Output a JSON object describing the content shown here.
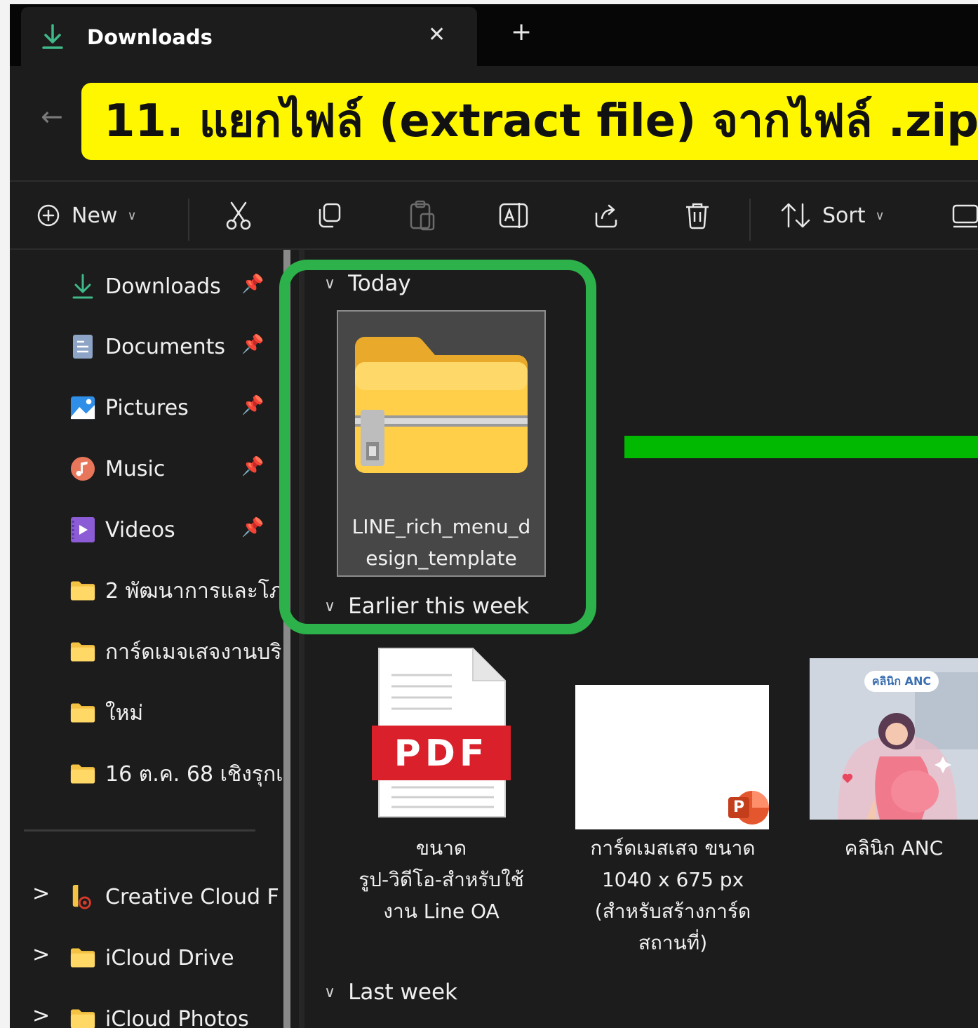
{
  "window": {
    "tab_title": "Downloads",
    "tab_close": "✕",
    "new_tab": "+",
    "back": "←"
  },
  "banner": {
    "text": "11. แยกไฟล์ (extract file) จากไฟล์ .zip",
    "color": "#fff700"
  },
  "toolbar": {
    "new_label": "New",
    "sort_label": "Sort",
    "icons": [
      "cut-icon",
      "copy-icon",
      "paste-icon",
      "rename-icon",
      "share-icon",
      "delete-icon",
      "view-icon"
    ]
  },
  "sidebar": {
    "quick_access": [
      {
        "label": "Downloads",
        "icon": "download-icon",
        "pinned": true
      },
      {
        "label": "Documents",
        "icon": "document-icon",
        "pinned": true
      },
      {
        "label": "Pictures",
        "icon": "pictures-icon",
        "pinned": true
      },
      {
        "label": "Music",
        "icon": "music-icon",
        "pinned": true
      },
      {
        "label": "Videos",
        "icon": "videos-icon",
        "pinned": true
      },
      {
        "label": "2 พัฒนาการและโภ",
        "icon": "folder-icon",
        "pinned": false
      },
      {
        "label": "การ์ดเมจเสจงานบริ",
        "icon": "folder-icon",
        "pinned": false
      },
      {
        "label": "ใหม่",
        "icon": "folder-icon",
        "pinned": false
      },
      {
        "label": "16 ต.ค. 68 เชิงรุกเ",
        "icon": "folder-icon",
        "pinned": false
      }
    ],
    "locations": [
      {
        "label": "Creative Cloud F",
        "icon": "creative-cloud-icon"
      },
      {
        "label": "iCloud Drive",
        "icon": "folder-icon"
      },
      {
        "label": "iCloud Photos",
        "icon": "folder-icon"
      }
    ],
    "expander": ">",
    "pin_glyph": "📌"
  },
  "content": {
    "groups": {
      "today": "Today",
      "earlier": "Earlier this week",
      "last_week": "Last week"
    },
    "files": {
      "zip_name_line1": "LINE_rich_menu_d",
      "zip_name_line2": "esign_template",
      "pdf_badge": "PDF",
      "pdf_line1": "ขนาด",
      "pdf_line2": "รูป-วิดีโอ-สำหรับใช้",
      "pdf_line3": "งาน Line OA",
      "ppt_badge": "P",
      "ppt_line1": "การ์ดเมสเสจ ขนาด",
      "ppt_line2": "1040 x 675 px",
      "ppt_line3": "(สำหรับสร้างการ์ด",
      "ppt_line4": "สถานที่)",
      "img_tag": "คลินิก ANC",
      "img_name": "คลินิก ANC"
    }
  },
  "annotation": {
    "highlight_color": "#2db14a",
    "arrow_color": "#00b900"
  }
}
